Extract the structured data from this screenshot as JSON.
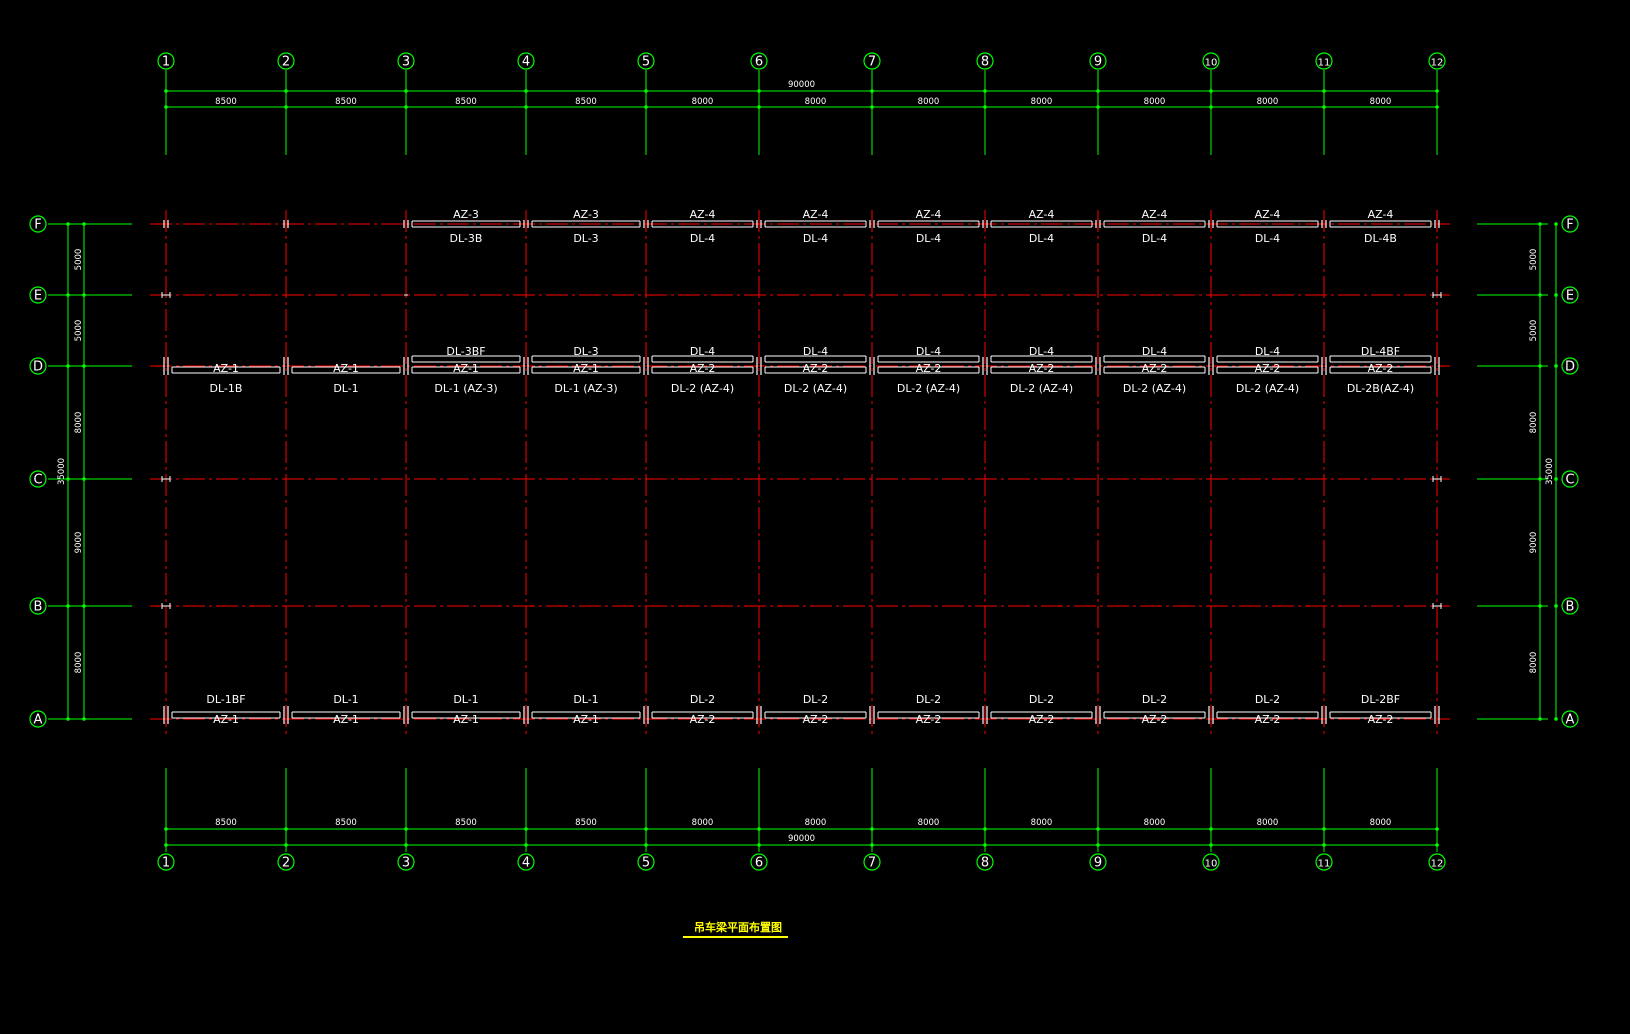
{
  "drawing": {
    "title": "吊车梁平面布置图",
    "colors": {
      "background": "#000000",
      "axis": "#00ff00",
      "gridline": "#ff0000",
      "beam": "#ffffff",
      "bubble": "#00ff00",
      "title": "#ffff00",
      "title_underline": "#ffff00"
    },
    "columns": [
      "1",
      "2",
      "3",
      "4",
      "5",
      "6",
      "7",
      "8",
      "9",
      "10",
      "11",
      "12"
    ],
    "rows": [
      "A",
      "B",
      "C",
      "D",
      "E",
      "F"
    ],
    "bay_spans": [
      "8500",
      "8500",
      "8500",
      "8500",
      "8000",
      "8000",
      "8000",
      "8000",
      "8000",
      "8000",
      "8000"
    ],
    "total_length": "90000",
    "row_spans": [
      "8000",
      "9000",
      "8000",
      "5000",
      "5000"
    ],
    "total_width": "35000",
    "row_F": {
      "upper_labels": [
        "",
        "",
        "AZ-3",
        "AZ-3",
        "AZ-4",
        "AZ-4",
        "AZ-4",
        "AZ-4",
        "AZ-4",
        "AZ-4",
        "AZ-4"
      ],
      "lower_labels": [
        "",
        "",
        "DL-3B",
        "DL-3",
        "DL-4",
        "DL-4",
        "DL-4",
        "DL-4",
        "DL-4",
        "DL-4",
        "DL-4B"
      ]
    },
    "row_D": {
      "upper_labels": [
        "",
        "",
        "DL-3BF",
        "DL-3",
        "DL-4",
        "DL-4",
        "DL-4",
        "DL-4",
        "DL-4",
        "DL-4",
        "DL-4BF"
      ],
      "middle_labels": [
        "AZ-1",
        "AZ-1",
        "AZ-1",
        "AZ-1",
        "AZ-2",
        "AZ-2",
        "AZ-2",
        "AZ-2",
        "AZ-2",
        "AZ-2",
        "AZ-2"
      ],
      "lower_labels": [
        "DL-1B",
        "DL-1",
        "DL-1 (AZ-3)",
        "DL-1  (AZ-3)",
        "DL-2 (AZ-4)",
        "DL-2 (AZ-4)",
        "DL-2 (AZ-4)",
        "DL-2 (AZ-4)",
        "DL-2 (AZ-4)",
        "DL-2  (AZ-4)",
        "DL-2B(AZ-4)"
      ]
    },
    "row_A": {
      "upper_labels": [
        "DL-1BF",
        "DL-1",
        "DL-1",
        "DL-1",
        "DL-2",
        "DL-2",
        "DL-2",
        "DL-2",
        "DL-2",
        "DL-2",
        "DL-2BF"
      ],
      "lower_labels": [
        "AZ-1",
        "AZ-1",
        "AZ-1",
        "AZ-1",
        "AZ-2",
        "AZ-2",
        "AZ-2",
        "AZ-2",
        "AZ-2",
        "AZ-2",
        "AZ-2"
      ]
    }
  }
}
